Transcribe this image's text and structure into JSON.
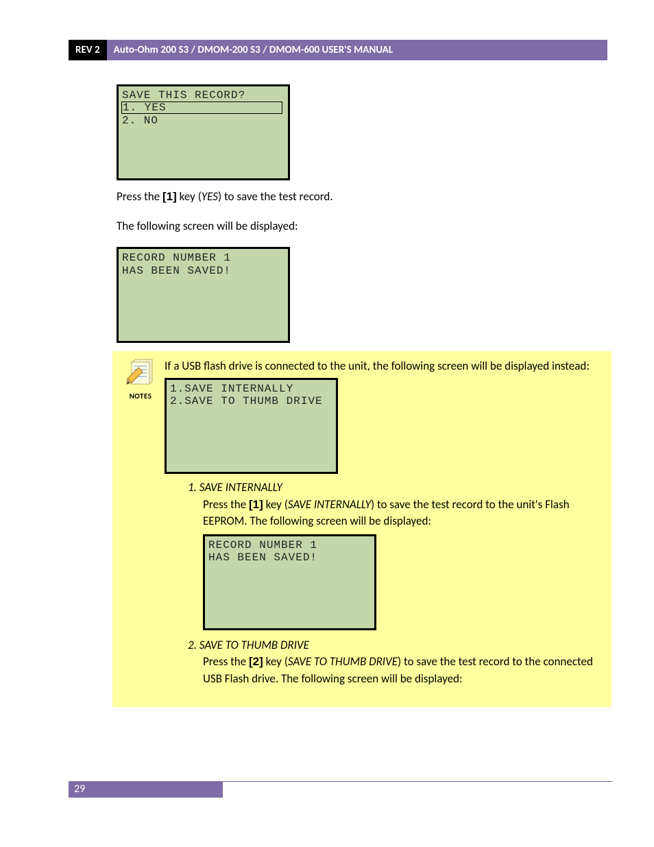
{
  "header": {
    "rev": "REV 2",
    "title": "Auto-Ohm 200 S3 / DMOM-200 S3 / DMOM-600 USER'S MANUAL"
  },
  "screen1": {
    "line1": "SAVE THIS RECORD?",
    "opt_yes": "1. YES",
    "opt_no": "2. NO"
  },
  "para1_a": "Press the ",
  "para1_key": "[1]",
  "para1_b": " key (",
  "para1_ital": "YES",
  "para1_c": ") to save the test record.",
  "para2": "The following screen will be displayed:",
  "screen2": {
    "line1": "RECORD NUMBER 1",
    "line2": "HAS BEEN SAVED!"
  },
  "notes": {
    "label": "NOTES",
    "intro": "If a USB flash drive is connected to the unit, the following screen will be displayed instead:",
    "screen3": {
      "line1": "1.SAVE INTERNALLY",
      "line2": "2.SAVE TO THUMB DRIVE"
    },
    "opt1": {
      "num": "1.",
      "title": "SAVE INTERNALLY",
      "body_a": "Press the ",
      "body_key": "[1]",
      "body_b": " key (",
      "body_ital": "SAVE INTERNALLY",
      "body_c": ") to save the test record to the unit's Flash EEPROM. The following screen will be displayed:",
      "screen": {
        "line1": "RECORD NUMBER 1",
        "line2": "HAS BEEN SAVED!"
      }
    },
    "opt2": {
      "num": "2.",
      "title": "SAVE TO THUMB DRIVE",
      "body_a": "Press the ",
      "body_key": "[2]",
      "body_b": " key (",
      "body_ital": "SAVE TO THUMB DRIVE",
      "body_c": ") to save the test record to the connected USB Flash drive. The following screen will be displayed:"
    }
  },
  "page_number": "29"
}
